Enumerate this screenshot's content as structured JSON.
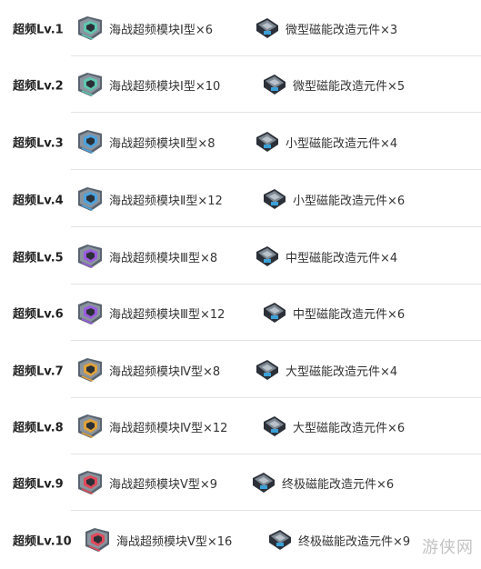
{
  "rows": [
    {
      "level": "超频Lv.1",
      "module": "海战超频模块Ⅰ型×6",
      "part": "微型磁能改造元件×3",
      "accent": "#5ec8b0"
    },
    {
      "level": "超频Lv.2",
      "module": "海战超频模块Ⅰ型×10",
      "part": "微型磁能改造元件×5",
      "accent": "#5ec8b0"
    },
    {
      "level": "超频Lv.3",
      "module": "海战超频模块Ⅱ型×8",
      "part": "小型磁能改造元件×4",
      "accent": "#4aa3e0"
    },
    {
      "level": "超频Lv.4",
      "module": "海战超频模块Ⅱ型×12",
      "part": "小型磁能改造元件×6",
      "accent": "#4aa3e0"
    },
    {
      "level": "超频Lv.5",
      "module": "海战超频模块Ⅲ型×8",
      "part": "中型磁能改造元件×4",
      "accent": "#9a5ce0"
    },
    {
      "level": "超频Lv.6",
      "module": "海战超频模块Ⅲ型×12",
      "part": "中型磁能改造元件×6",
      "accent": "#9a5ce0"
    },
    {
      "level": "超频Lv.7",
      "module": "海战超频模块Ⅳ型×8",
      "part": "大型磁能改造元件×4",
      "accent": "#e0a23a"
    },
    {
      "level": "超频Lv.8",
      "module": "海战超频模块Ⅳ型×12",
      "part": "大型磁能改造元件×6",
      "accent": "#e0a23a"
    },
    {
      "level": "超频Lv.9",
      "module": "海战超频模块Ⅴ型×9",
      "part": "终极磁能改造元件×6",
      "accent": "#e04a5a"
    },
    {
      "level": "超频Lv.10",
      "module": "海战超频模块Ⅴ型×16",
      "part": "终极磁能改造元件×9",
      "accent": "#e04a5a"
    }
  ],
  "icons": {
    "module": "overclock-module-icon",
    "part": "magnetic-component-icon"
  },
  "watermark": "游侠网"
}
